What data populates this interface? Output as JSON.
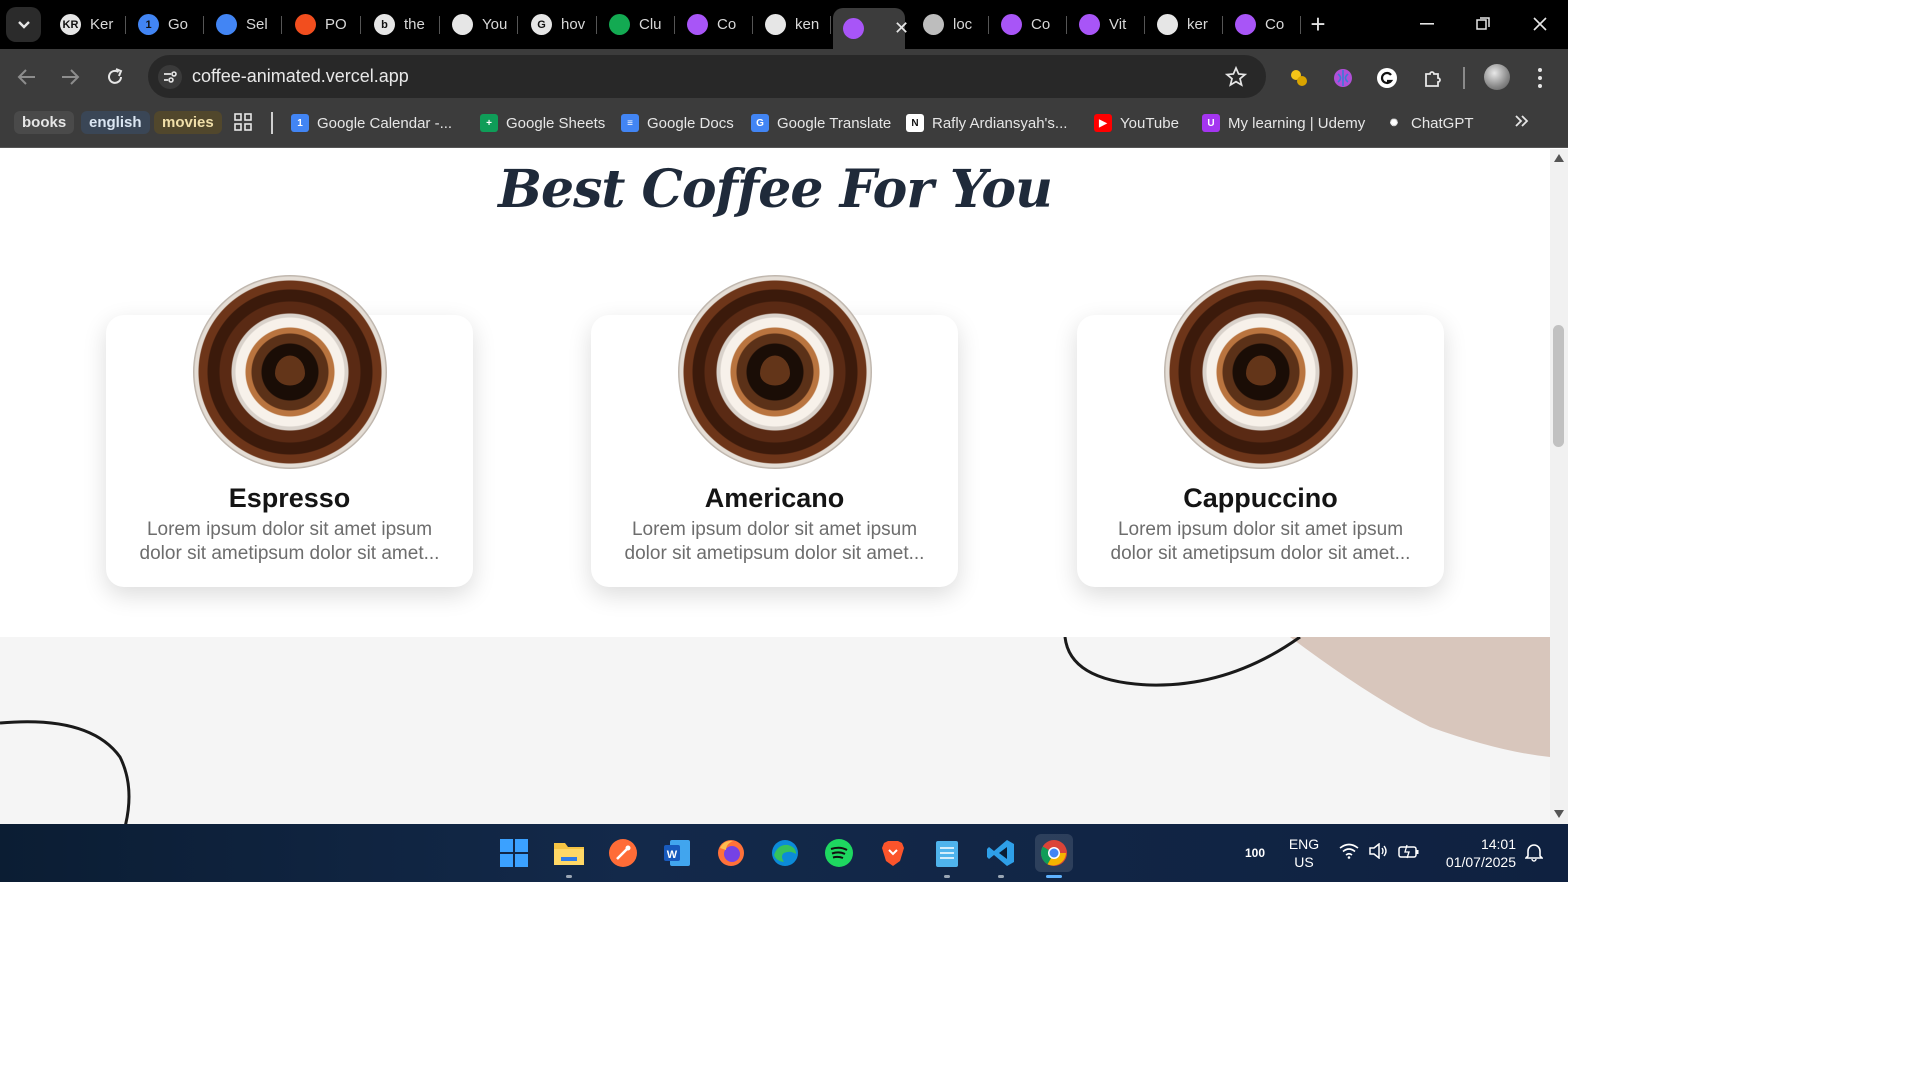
{
  "browser": {
    "tabs": [
      {
        "label": "Ker",
        "icon": "avatar-kr-icon",
        "fav": "KR",
        "color": "#e6e6e6"
      },
      {
        "label": "Go",
        "icon": "google-calendar-icon",
        "fav": "1",
        "color": "#4285f4"
      },
      {
        "label": "Sel",
        "icon": "google-docs-icon",
        "fav": "",
        "color": "#4285f4"
      },
      {
        "label": "PO",
        "icon": "figma-icon",
        "fav": "",
        "color": "#f24e1e"
      },
      {
        "label": "the",
        "icon": "b-logo-icon",
        "fav": "b",
        "color": "#e6e6e6"
      },
      {
        "label": "You",
        "icon": "github-icon",
        "fav": "",
        "color": "#e6e6e6"
      },
      {
        "label": "hov",
        "icon": "google-icon",
        "fav": "G",
        "color": "#e6e6e6"
      },
      {
        "label": "Clu",
        "icon": "mongodb-icon",
        "fav": "",
        "color": "#13aa52"
      },
      {
        "label": "Co",
        "icon": "vite-icon",
        "fav": "",
        "color": "#a855f7"
      },
      {
        "label": "ken",
        "icon": "github-icon",
        "fav": "",
        "color": "#e6e6e6"
      },
      {
        "label": "",
        "icon": "vite-icon",
        "fav": "",
        "color": "#a855f7",
        "active": true
      },
      {
        "label": "loc",
        "icon": "globe-icon",
        "fav": "",
        "color": "#bdbdbd"
      },
      {
        "label": "Co",
        "icon": "vite-icon",
        "fav": "",
        "color": "#a855f7"
      },
      {
        "label": "Vit",
        "icon": "vite-icon",
        "fav": "",
        "color": "#a855f7"
      },
      {
        "label": "ker",
        "icon": "github-icon",
        "fav": "",
        "color": "#e6e6e6"
      },
      {
        "label": "Co",
        "icon": "vite-icon",
        "fav": "",
        "color": "#a855f7"
      }
    ],
    "url": "coffee-animated.vercel.app",
    "bookmark_groups": [
      {
        "label": "books",
        "bg": "#4a4a4a",
        "fg": "#e6e6e6"
      },
      {
        "label": "english",
        "bg": "#3a4656",
        "fg": "#dbe6f2"
      },
      {
        "label": "movies",
        "bg": "#51472c",
        "fg": "#f0dfa9"
      }
    ],
    "bookmarks": [
      {
        "label": "Google Calendar -...",
        "icon": "google-calendar-icon",
        "color": "#4285f4",
        "glyph": "1"
      },
      {
        "label": "Google Sheets",
        "icon": "google-sheets-icon",
        "color": "#0f9d58",
        "glyph": "+"
      },
      {
        "label": "Google Docs",
        "icon": "google-docs-icon",
        "color": "#4285f4",
        "glyph": "≡"
      },
      {
        "label": "Google Translate",
        "icon": "google-translate-icon",
        "color": "#4285f4",
        "glyph": "G"
      },
      {
        "label": "Rafly Ardiansyah's...",
        "icon": "notion-icon",
        "color": "#ffffff",
        "glyph": "N"
      },
      {
        "label": "YouTube",
        "icon": "youtube-icon",
        "color": "#ff0000",
        "glyph": "▶"
      },
      {
        "label": "My learning | Udemy",
        "icon": "udemy-icon",
        "color": "#a435f0",
        "glyph": "U"
      },
      {
        "label": "ChatGPT",
        "icon": "chatgpt-icon",
        "color": "#3c3c3c",
        "glyph": "✺"
      }
    ]
  },
  "page": {
    "title": "Best Coffee For You",
    "cards": [
      {
        "title": "Espresso",
        "desc_line1": "Lorem ipsum dolor sit amet ipsum",
        "desc_line2": "dolor sit ametipsum dolor sit amet..."
      },
      {
        "title": "Americano",
        "desc_line1": "Lorem ipsum dolor sit amet ipsum",
        "desc_line2": "dolor sit ametipsum dolor sit amet..."
      },
      {
        "title": "Cappuccino",
        "desc_line1": "Lorem ipsum dolor sit amet ipsum",
        "desc_line2": "dolor sit ametipsum dolor sit amet..."
      }
    ]
  },
  "taskbar": {
    "apps": [
      "windows-start-icon",
      "file-explorer-icon",
      "postman-icon",
      "word-icon",
      "firefox-icon",
      "edge-icon",
      "spotify-icon",
      "brave-icon",
      "notepad-icon",
      "vscode-icon",
      "chrome-icon"
    ],
    "battery": "100",
    "lang_line1": "ENG",
    "lang_line2": "US",
    "time": "14:01",
    "date": "01/07/2025"
  }
}
